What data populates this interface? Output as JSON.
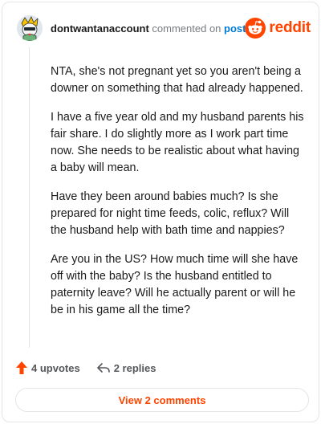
{
  "comment": {
    "username": "dontwantanaccount",
    "commented_text": "commented on",
    "post_link": "post",
    "brand": "reddit",
    "paragraphs": [
      "NTA, she's not pregnant yet so you aren't being a downer on something that had already happened.",
      "I have a five year old and my husband parents his fair share. I do slightly more as I work part time now. She needs to be realistic about what having a baby will mean.",
      "Have they been around babies much? Is she prepared for night time feeds, colic, reflux? Will the husband help with bath time and nappies?",
      "Are you in the US? How much time will she have off with the baby? Is the husband entitled to paternity leave? Will he actually parent or will he be in his game all the time?"
    ]
  },
  "actions": {
    "upvotes": "4 upvotes",
    "replies": "2 replies"
  },
  "view_comments": "View 2 comments",
  "colors": {
    "accent": "#ff4500",
    "link": "#0079d3",
    "muted": "#787c7e"
  },
  "icons": [
    "avatar",
    "reddit-logo-icon",
    "upvote-arrow-icon",
    "reply-icon"
  ]
}
